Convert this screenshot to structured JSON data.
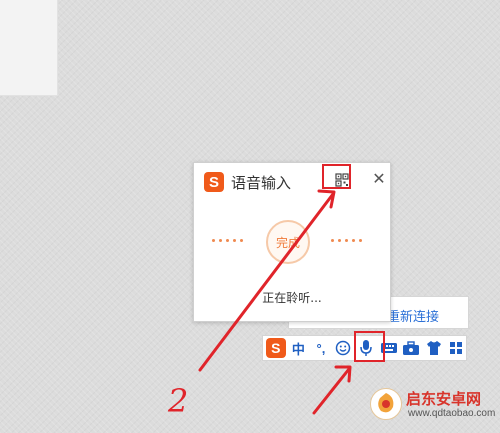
{
  "popup": {
    "title": "语音输入",
    "logo": "S",
    "done_label": "完成",
    "status": "正在聆听...",
    "close_label": "✕"
  },
  "reconnect": {
    "label": "重新连接"
  },
  "toolbar": {
    "logo": "S",
    "lang": "中",
    "punct": "°,",
    "items": [
      "emoji-icon",
      "microphone-icon",
      "keyboard-icon",
      "toolbox-icon",
      "skin-icon",
      "menu-grid-icon"
    ]
  },
  "annotation": {
    "number": "2"
  },
  "watermark": {
    "title": "启东安卓网",
    "url": "www.qdtaobao.com"
  },
  "colors": {
    "brand": "#f05a1a",
    "highlight": "#e0242a",
    "toolbar_icon": "#1f5fc2",
    "link": "#2a6fd6"
  }
}
